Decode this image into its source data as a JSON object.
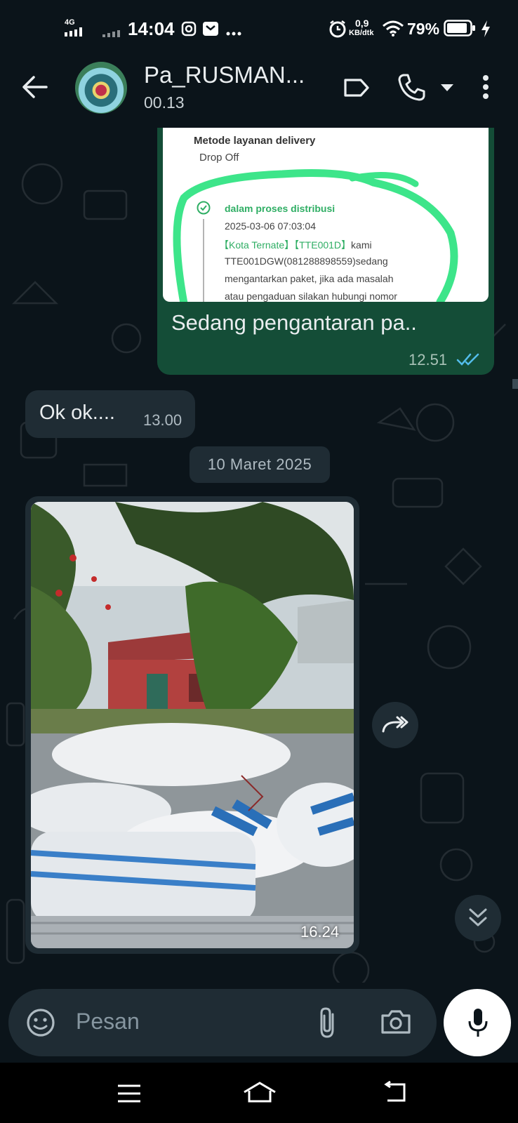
{
  "status_bar": {
    "network": "4G",
    "time": "14:04",
    "speed_value": "0,9",
    "speed_unit": "KB/dtk",
    "battery": "79%"
  },
  "header": {
    "contact_name": "Pa_RUSMAN...",
    "subtitle": "00.13",
    "icons": [
      "back-arrow-icon",
      "label-icon",
      "phone-icon",
      "dropdown-icon",
      "more-icon"
    ]
  },
  "messages": {
    "outgoing": {
      "shot_heading": "Metode layanan delivery",
      "shot_method": "Drop Off",
      "shot_status": "dalam proses distribusi",
      "shot_datetime": "2025-03-06 07:03:04",
      "shot_location": "【Kota Ternate】【TTE001D】",
      "shot_line1_rest": "kami",
      "shot_line2": "TTE001DGW(081288898559)sedang",
      "shot_line3": "mengantarkan paket, jika ada masalah",
      "shot_line4": "atau pengaduan silakan hubungi nomor",
      "text": "Sedang pengantaran pa..",
      "time": "12.51",
      "read_status": "read"
    },
    "incoming": {
      "text": "Ok ok....",
      "time": "13.00"
    },
    "date_separator": "10 Maret 2025",
    "image_message": {
      "time": "16.24"
    }
  },
  "composer": {
    "placeholder": "Pesan"
  },
  "colors": {
    "background": "#0b141a",
    "outgoing_bubble": "#144d37",
    "incoming_bubble": "#1f2c34",
    "read_ticks": "#53bdeb",
    "status_green": "#2fae64"
  }
}
